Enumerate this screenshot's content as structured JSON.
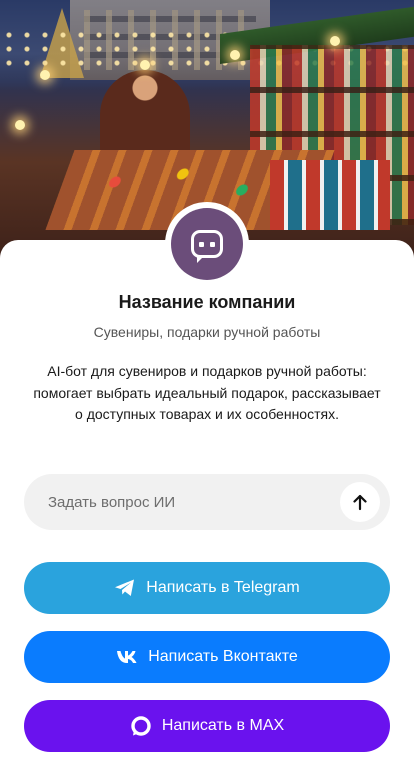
{
  "company": {
    "name": "Название компании",
    "subtitle": "Сувениры, подарки ручной работы",
    "description": "AI-бот для сувениров и подарков ручной работы: помогает выбрать идеальный подарок, рассказывает о доступных товарах и их особенностях."
  },
  "ask": {
    "placeholder": "Задать вопрос ИИ",
    "send_icon": "arrow-up-icon"
  },
  "buttons": {
    "telegram": {
      "label": "Написать в Telegram",
      "icon": "telegram-icon",
      "color": "#2aa3dd"
    },
    "vk": {
      "label": "Написать Вконтакте",
      "icon": "vk-icon",
      "color": "#0a7cfe"
    },
    "max": {
      "label": "Написать в MAX",
      "icon": "max-icon",
      "color": "#6a12ee"
    }
  },
  "avatar": {
    "icon": "chat-bubble-icon",
    "color": "#6b4d7a"
  }
}
